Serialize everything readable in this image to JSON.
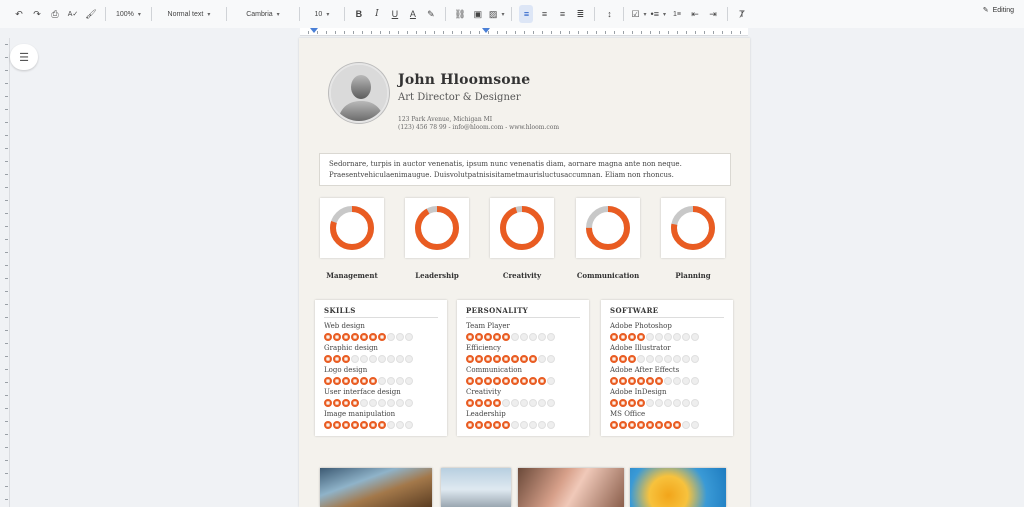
{
  "toolbar": {
    "zoom": "100%",
    "style": "Normal text",
    "font": "Cambria",
    "size": "10",
    "mode": "Editing"
  },
  "resume": {
    "name": "John Hloomsone",
    "title": "Art Director & Designer",
    "address": "123 Park Avenue, Michigan MI",
    "contact": "(123) 456 78 99 - info@hloom.com - www.hloom.com",
    "summary_line1": "Sedornare, turpis in auctor venenatis, ipsum nunc venenatis diam, aornare magna ante non neque.",
    "summary_line2": "Praesentvehiculaenimaugue. Duisvolutpatnisisitametmaurisluctusaccumnan. Eliam non rhoncus.",
    "competencies": [
      {
        "label": "Management",
        "level": 0.8
      },
      {
        "label": "Leadership",
        "level": 0.92
      },
      {
        "label": "Creativity",
        "level": 0.95
      },
      {
        "label": "Communication",
        "level": 0.75
      },
      {
        "label": "Planning",
        "level": 0.78
      }
    ],
    "panels": [
      {
        "title": "SKILLS",
        "items": [
          {
            "name": "Web design",
            "rating": 7,
            "max": 10
          },
          {
            "name": "Graphic design",
            "rating": 3,
            "max": 10
          },
          {
            "name": "Logo design",
            "rating": 6,
            "max": 10
          },
          {
            "name": "User interface design",
            "rating": 4,
            "max": 10
          },
          {
            "name": "Image manipulation",
            "rating": 7,
            "max": 10
          }
        ]
      },
      {
        "title": "PERSONALITY",
        "items": [
          {
            "name": "Team Player",
            "rating": 5,
            "max": 10
          },
          {
            "name": "Efficiency",
            "rating": 8,
            "max": 10
          },
          {
            "name": "Communication",
            "rating": 9,
            "max": 10
          },
          {
            "name": "Creativity",
            "rating": 4,
            "max": 10
          },
          {
            "name": "Leadership",
            "rating": 5,
            "max": 10
          }
        ]
      },
      {
        "title": "SOFTWARE",
        "items": [
          {
            "name": "Adobe Photoshop",
            "rating": 4,
            "max": 10
          },
          {
            "name": "Adobe Illustrator",
            "rating": 3,
            "max": 10
          },
          {
            "name": "Adobe After Effects",
            "rating": 6,
            "max": 10
          },
          {
            "name": "Adobe InDesign",
            "rating": 4,
            "max": 10
          },
          {
            "name": "MS Office",
            "rating": 8,
            "max": 10
          }
        ]
      }
    ]
  },
  "colors": {
    "accent": "#e95c22",
    "ring_track": "#c8c8c8"
  }
}
